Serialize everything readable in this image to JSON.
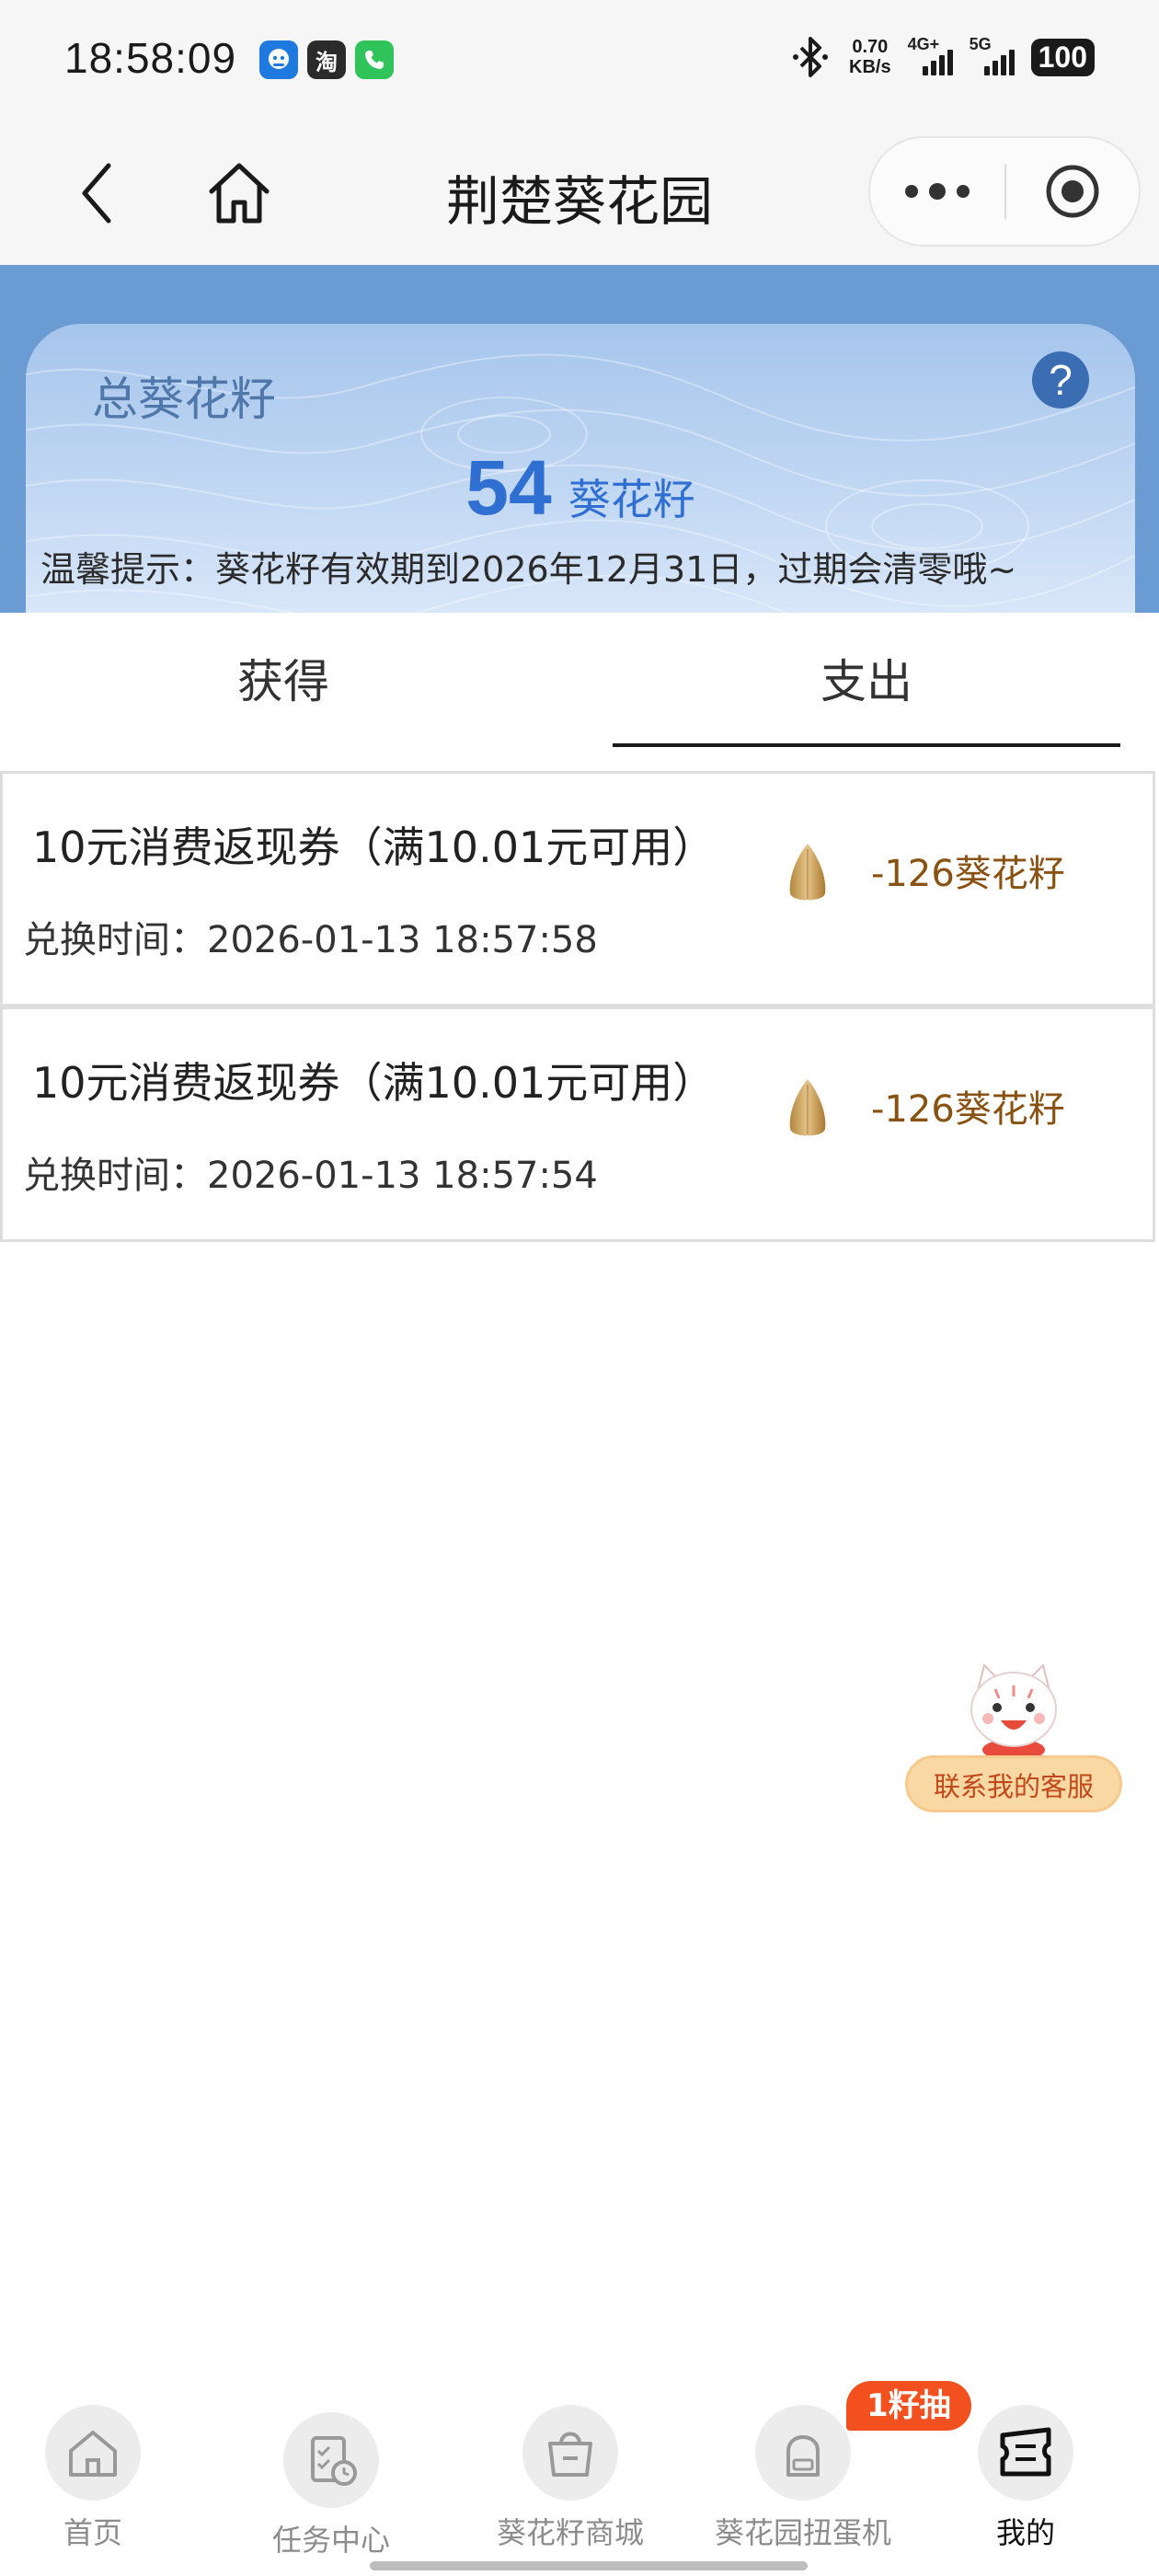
{
  "status_bar": {
    "time": "18:58:09",
    "app_icons": [
      "chat-app-icon",
      "taobao-icon",
      "phone-call-icon"
    ],
    "taobao_glyph": "淘",
    "net_speed_value": "0.70",
    "net_speed_unit": "KB/s",
    "signal_1_label": "4G+",
    "signal_2_label": "5G",
    "battery": "100"
  },
  "nav": {
    "title": "荆楚葵花园"
  },
  "summary": {
    "label": "总葵花籽",
    "help_glyph": "?",
    "amount": "54",
    "unit": "葵花籽",
    "tip": "温馨提示：葵花籽有效期到2026年12月31日，过期会清零哦~"
  },
  "tabs": {
    "earn": "获得",
    "spend": "支出",
    "active": "spend"
  },
  "records": [
    {
      "title": "10元消费返现券（满10.01元可用）",
      "time": "兑换时间：2026-01-13 18:57:58",
      "amount": "-126葵花籽"
    },
    {
      "title": "10元消费返现券（满10.01元可用）",
      "time": "兑换时间：2026-01-13 18:57:54",
      "amount": "-126葵花籽"
    }
  ],
  "customer_service": {
    "label": "联系我的客服"
  },
  "tabbar": {
    "items": [
      {
        "label": "首页",
        "icon": "home-icon"
      },
      {
        "label": "任务中心",
        "icon": "task-icon"
      },
      {
        "label": "葵花籽商城",
        "icon": "shopping-bag-icon"
      },
      {
        "label": "葵花园扭蛋机",
        "icon": "gacha-machine-icon"
      },
      {
        "label": "我的",
        "icon": "ticket-icon"
      }
    ],
    "active_index": 4,
    "lottery_badge": "1籽抽"
  },
  "colors": {
    "accent_blue": "#2f6fd2",
    "header_bg": "#6a9bd2",
    "amount_brown": "#8a5212",
    "badge_red": "#f2511f"
  }
}
